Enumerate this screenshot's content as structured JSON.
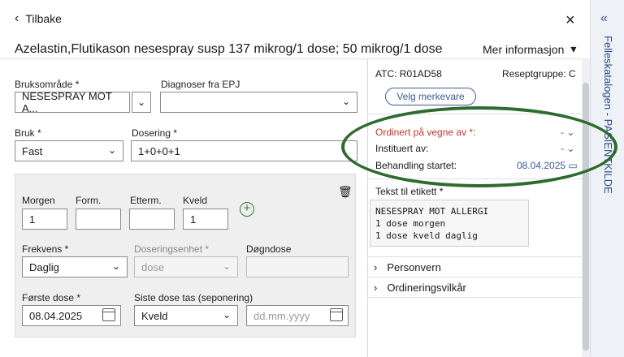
{
  "header": {
    "back_label": "Tilbake",
    "close": "×",
    "title": "Azelastin,Flutikason  nesespray susp 137 mikrog/1 dose; 50 mikrog/1 dose",
    "more_label": "Mer informasjon"
  },
  "left": {
    "bruksomrade_label": "Bruksområde *",
    "bruksomrade_value": "NESESPRAY MOT A...",
    "diagnoser_label": "Diagnoser fra EPJ",
    "diagnoser_value": "",
    "bruk_label": "Bruk *",
    "bruk_value": "Fast",
    "dosering_label": "Dosering *",
    "dosering_value": "1+0+0+1",
    "card": {
      "morgen_label": "Morgen",
      "morgen_value": "1",
      "form_label": "Form.",
      "form_value": "",
      "etterm_label": "Etterm.",
      "etterm_value": "",
      "kveld_label": "Kveld",
      "kveld_value": "1",
      "frekvens_label": "Frekvens *",
      "frekvens_value": "Daglig",
      "doseringsenhet_label": "Doseringsenhet *",
      "doseringsenhet_value": "dose",
      "dognsdose_label": "Døgndose",
      "dognsdose_value": "",
      "forste_dose_label": "Første dose *",
      "forste_dose_value": "08.04.2025",
      "siste_dose_label": "Siste dose tas (seponering)",
      "siste_dose_value": "Kveld",
      "siste_dato_placeholder": "dd.mm.yyyy"
    }
  },
  "right": {
    "atc": "ATC: R01AD58",
    "reseptgruppe": "Reseptgruppe: C",
    "velg_merkevare": "Velg merkevare",
    "ordinert_label": "Ordinert på vegne av *:",
    "ordinert_value": "-",
    "instituert_label": "Instituert av:",
    "instituert_value": "-",
    "behandling_label": "Behandling startet:",
    "behandling_value": "08.04.2025",
    "etikett_label": "Tekst til etikett *",
    "etikett_text": "NESESPRAY MOT ALLERGI\n1 dose morgen\n1 dose kveld daglig",
    "personvern": "Personvern",
    "ordineringsvilkar": "Ordineringsvilkår"
  },
  "sidebar": {
    "label": "Felleskatalogen - PASIENTKILDE"
  },
  "colors": {
    "accent": "#3c5a99",
    "required_red": "#c0362c",
    "highlight_green": "#2e6b2f"
  }
}
